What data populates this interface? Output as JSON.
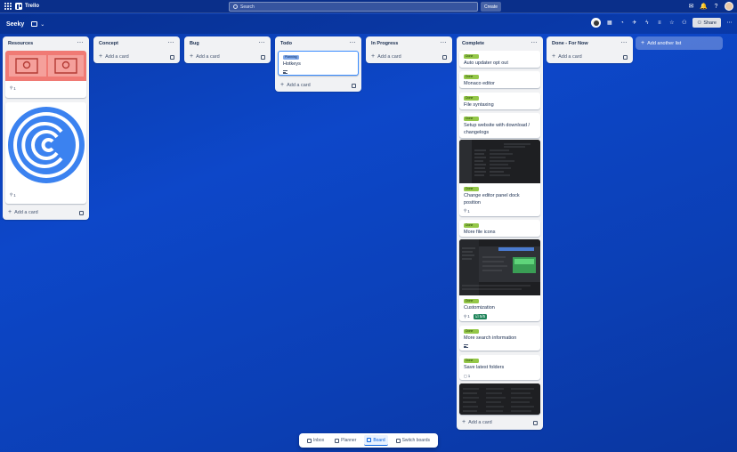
{
  "app": {
    "name": "Trello"
  },
  "search": {
    "placeholder": "Search"
  },
  "header": {
    "create_label": "Create"
  },
  "board": {
    "title": "Seeky",
    "share_label": "Share"
  },
  "lists": {
    "resources": {
      "title": "Resources",
      "cards": [
        {
          "attachments": "1"
        },
        {
          "attachments": "1"
        }
      ],
      "add_label": "Add a card"
    },
    "concept": {
      "title": "Concept",
      "add_label": "Add a card"
    },
    "bug": {
      "title": "Bug",
      "add_label": "Add a card"
    },
    "todo": {
      "title": "Todo",
      "cards": [
        {
          "label": "Planning",
          "title": "Hotkeys"
        }
      ],
      "add_label": "Add a card"
    },
    "in_progress": {
      "title": "In Progress",
      "add_label": "Add a card"
    },
    "complete": {
      "title": "Complete",
      "cards": [
        {
          "label": "Done",
          "title": "Auto updater opt out"
        },
        {
          "label": "Done",
          "title": "Monaco editor"
        },
        {
          "label": "Done",
          "title": "File syntaxing"
        },
        {
          "label": "Done",
          "title": "Setup website with download / changelogs"
        },
        {
          "label": "Done",
          "title": "Change editor panel dock position",
          "attachments": "1"
        },
        {
          "label": "Done",
          "title": "More file icons"
        },
        {
          "label": "Done",
          "title": "Customization",
          "attachments": "1",
          "checklist": "5/5"
        },
        {
          "label": "Done",
          "title": "More search information"
        },
        {
          "label": "Done",
          "title": "Save latest folders",
          "comments": "1"
        }
      ],
      "add_label": "Add a card"
    },
    "done_for_now": {
      "title": "Done - For Now",
      "add_label": "Add a card"
    }
  },
  "add_list_label": "Add another list",
  "switcher": {
    "inbox": "Inbox",
    "planner": "Planner",
    "board": "Board",
    "switch": "Switch boards"
  },
  "colors": {
    "label_done": "#94c748",
    "label_planning": "#7fa8e8",
    "accent": "#0c66e4"
  }
}
